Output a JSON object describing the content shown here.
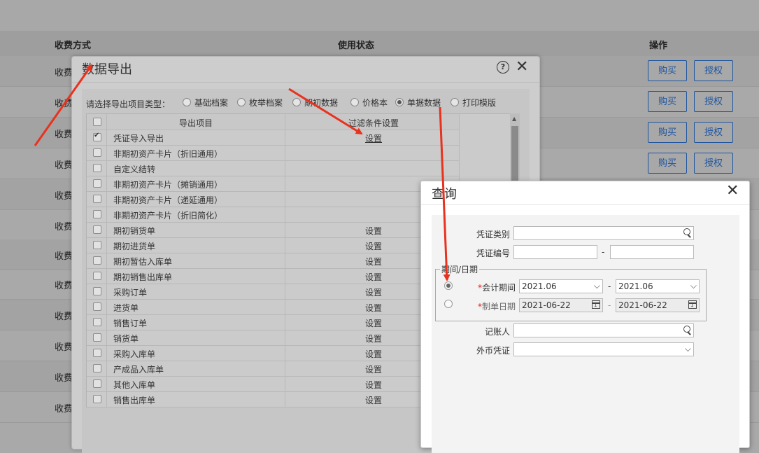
{
  "background": {
    "columns": {
      "pay_method": "收费方式",
      "usage_status": "使用状态",
      "actions": "操作"
    },
    "row_text": "收费",
    "buy_label": "购买",
    "auth_label": "授权",
    "accent_color": "#1e55a0"
  },
  "export_dialog": {
    "title": "数据导出",
    "help_icon": "?",
    "type_label": "请选择导出项目类型：",
    "types": [
      {
        "label": "基础档案",
        "selected": false
      },
      {
        "label": "枚举档案",
        "selected": false
      },
      {
        "label": "期初数据",
        "selected": false
      },
      {
        "label": "价格本",
        "selected": false
      },
      {
        "label": "单据数据",
        "selected": true
      },
      {
        "label": "打印模版",
        "selected": false
      }
    ],
    "table": {
      "headers": {
        "item": "导出项目",
        "filter": "过滤条件设置"
      },
      "rows": [
        {
          "name": "凭证导入导出",
          "checked": true,
          "action": "设置"
        },
        {
          "name": "非期初资产卡片（折旧通用）",
          "checked": false,
          "action": ""
        },
        {
          "name": "自定义结转",
          "checked": false,
          "action": ""
        },
        {
          "name": "非期初资产卡片（摊销通用）",
          "checked": false,
          "action": ""
        },
        {
          "name": "非期初资产卡片（递延通用）",
          "checked": false,
          "action": ""
        },
        {
          "name": "非期初资产卡片（折旧简化）",
          "checked": false,
          "action": ""
        },
        {
          "name": "期初销货单",
          "checked": false,
          "action": "设置"
        },
        {
          "name": "期初进货单",
          "checked": false,
          "action": "设置"
        },
        {
          "name": "期初暂估入库单",
          "checked": false,
          "action": "设置"
        },
        {
          "name": "期初销售出库单",
          "checked": false,
          "action": "设置"
        },
        {
          "name": "采购订单",
          "checked": false,
          "action": "设置"
        },
        {
          "name": "进货单",
          "checked": false,
          "action": "设置"
        },
        {
          "name": "销售订单",
          "checked": false,
          "action": "设置"
        },
        {
          "name": "销货单",
          "checked": false,
          "action": "设置"
        },
        {
          "name": "采购入库单",
          "checked": false,
          "action": "设置"
        },
        {
          "name": "产成品入库单",
          "checked": false,
          "action": "设置"
        },
        {
          "name": "其他入库单",
          "checked": false,
          "action": "设置"
        },
        {
          "name": "销售出库单",
          "checked": false,
          "action": "设置"
        }
      ]
    }
  },
  "query_dialog": {
    "title": "查询",
    "voucher_type": {
      "label": "凭证类别",
      "value": ""
    },
    "voucher_no": {
      "label": "凭证编号",
      "from": "",
      "to": ""
    },
    "period_group": "期间/日期",
    "accounting_period": {
      "label": "会计期间",
      "from": "2021.06",
      "to": "2021.06",
      "selected": true
    },
    "voucher_date": {
      "label": "制单日期",
      "from": "2021-06-22",
      "to": "2021-06-22",
      "selected": false
    },
    "bookkeeper": {
      "label": "记账人",
      "value": ""
    },
    "foreign_currency": {
      "label": "外币凭证",
      "value": ""
    },
    "dash": "-",
    "required_mark": "*"
  },
  "annotation_color": "#e8321e"
}
